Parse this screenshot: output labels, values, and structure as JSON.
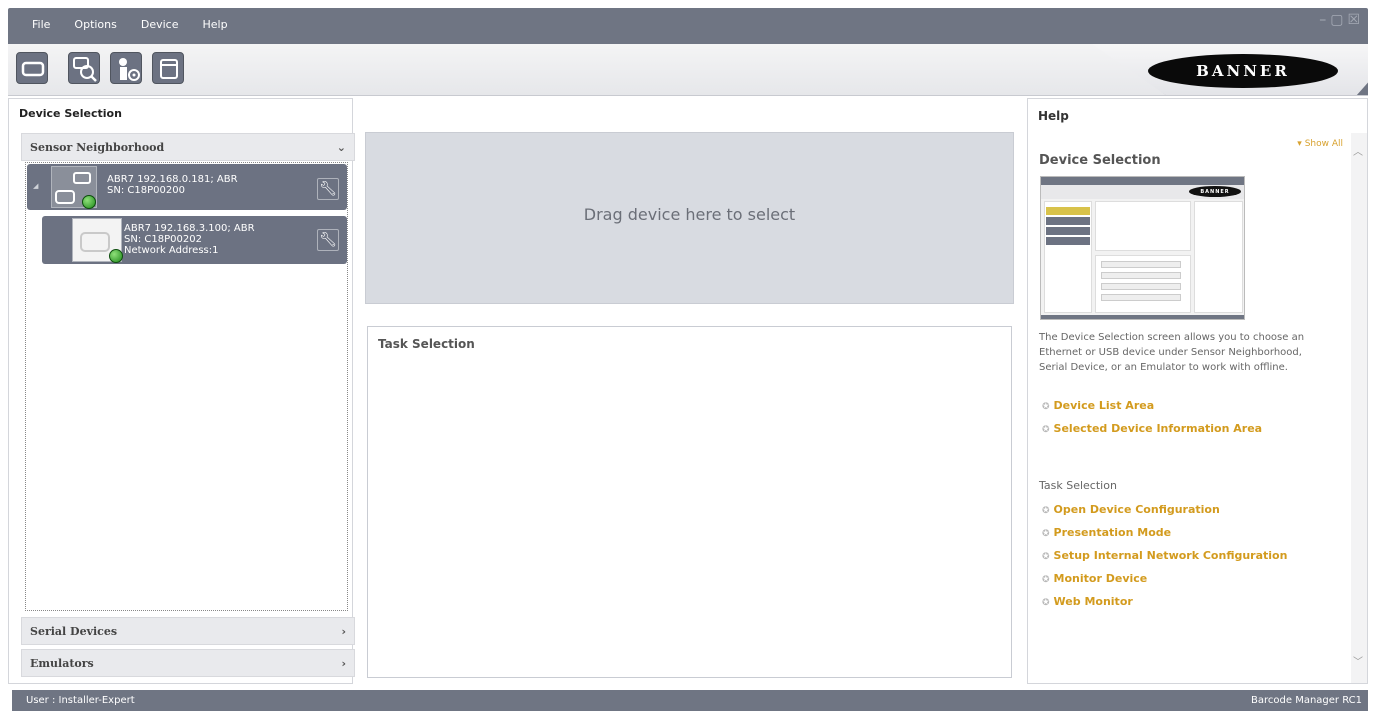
{
  "menu": {
    "items": [
      "File",
      "Options",
      "Device",
      "Help"
    ]
  },
  "window_controls": {
    "minimize": "–",
    "restore": "▢",
    "close": "☒"
  },
  "toolbar": {
    "buttons": [
      "device-icon",
      "search-device-icon",
      "user-settings-icon",
      "window-icon"
    ]
  },
  "brand": {
    "logo_text": "BANNER"
  },
  "left_panel": {
    "title": "Device Selection",
    "sections": {
      "sensor": "Sensor Neighborhood",
      "serial": "Serial Devices",
      "emulators": "Emulators"
    },
    "devices": [
      {
        "name": "ABR7 192.168.0.181; ABR",
        "sn": "SN: C18P00200",
        "extra": ""
      },
      {
        "name": "ABR7 192.168.3.100; ABR",
        "sn": "SN: C18P00202",
        "extra": "Network Address:1"
      }
    ]
  },
  "center": {
    "drop_text": "Drag device here to select",
    "task_title": "Task Selection"
  },
  "help": {
    "title": "Help",
    "show_all": "Show All",
    "heading": "Device Selection",
    "thumb_logo": "BANNER",
    "description": "The Device Selection screen allows you to choose an Ethernet or USB device under Sensor Neighborhood, Serial Device, or an Emulator to work with offline.",
    "links_area": [
      "Device List Area",
      "Selected Device Information Area"
    ],
    "subheading": "Task Selection",
    "links_tasks": [
      "Open Device Configuration",
      "Presentation Mode",
      "Setup Internal Network Configuration",
      "Monitor Device",
      "Web Monitor"
    ]
  },
  "status": {
    "user": "User : Installer-Expert",
    "app": "Barcode Manager RC1"
  },
  "colors": {
    "chrome": "#6f7583",
    "link": "#d39b1e",
    "drop_zone": "#d8dbe1"
  }
}
